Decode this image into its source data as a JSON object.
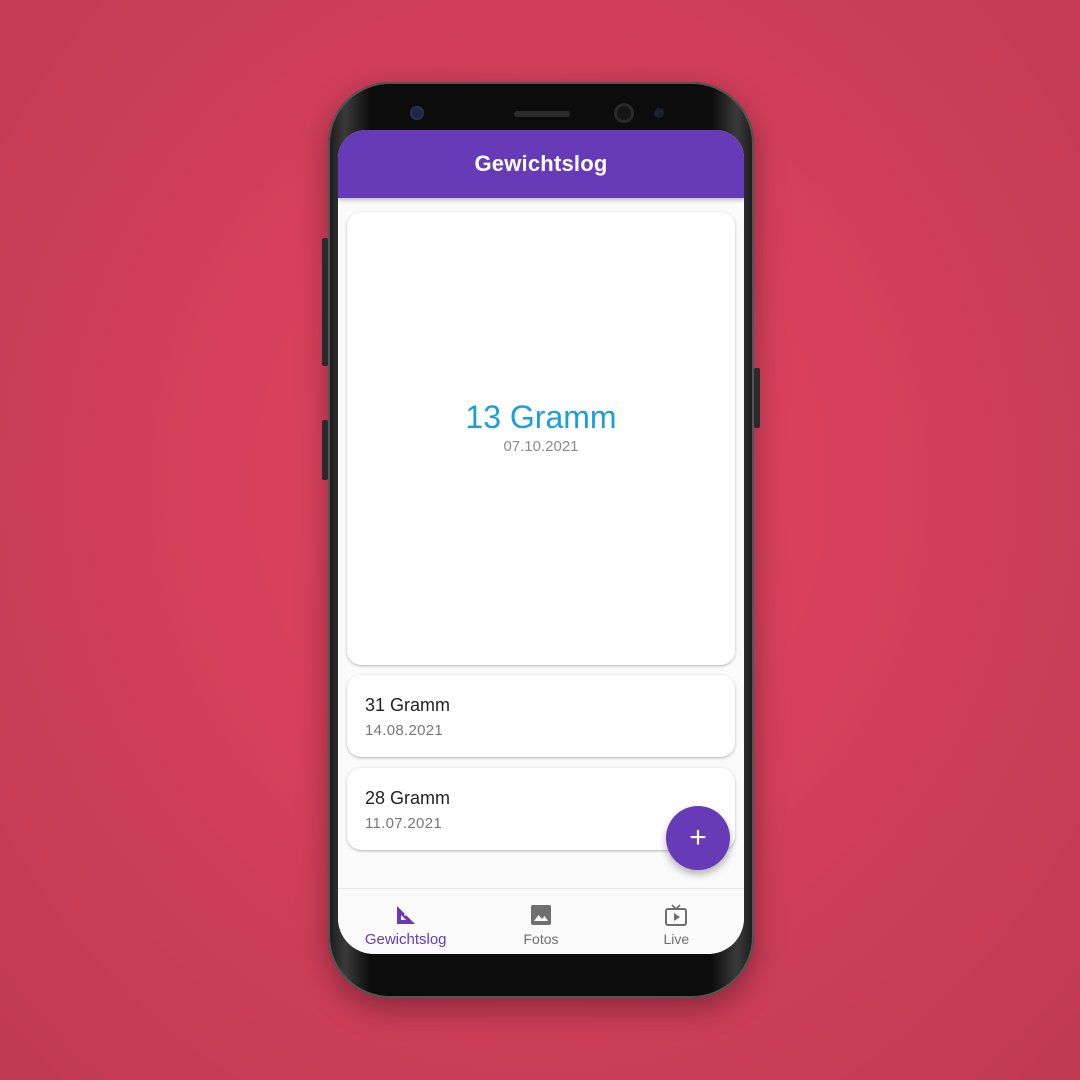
{
  "colors": {
    "background": "#d6405c",
    "primary": "#673ab7",
    "highlight_weight": "#1a9fdb"
  },
  "appbar": {
    "title": "Gewichtslog"
  },
  "latest_entry": {
    "weight": "13 Gramm",
    "date": "07.10.2021"
  },
  "entries": [
    {
      "weight": "31 Gramm",
      "date": "14.08.2021"
    },
    {
      "weight": "28 Gramm",
      "date": "11.07.2021"
    }
  ],
  "fab": {
    "icon": "plus-icon",
    "symbol": "+"
  },
  "bottom_nav": {
    "active": "Gewichtslog",
    "items": [
      {
        "label": "Gewichtslog",
        "icon": "set-square-icon"
      },
      {
        "label": "Fotos",
        "icon": "image-icon"
      },
      {
        "label": "Live",
        "icon": "live-tv-icon"
      }
    ]
  }
}
